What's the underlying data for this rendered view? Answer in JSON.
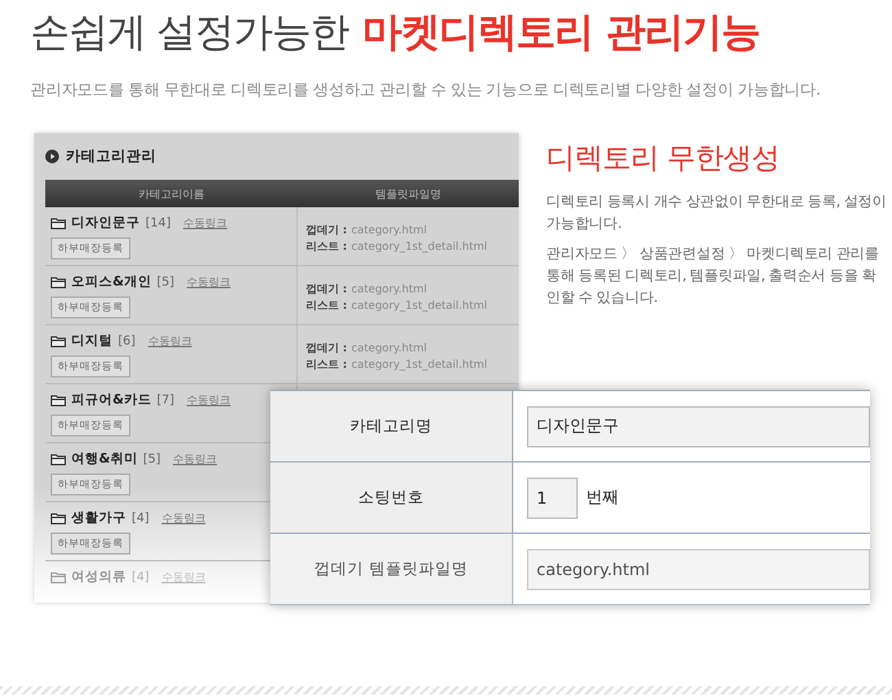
{
  "header": {
    "title": "손쉽게 설정가능한",
    "title_highlight": "마켓디렉토리 관리기능",
    "subtitle": "관리자모드를 통해 무한대로 디렉토리를 생성하고 관리할 수 있는 기능으로 디렉토리별 다양한 설정이 가능합니다."
  },
  "panel": {
    "title": "카테고리관리",
    "columns": [
      "카테고리이름",
      "템플릿파일명"
    ],
    "rows": [
      {
        "name": "디자인문구",
        "count": "[14]",
        "link": "수동링크",
        "button": "하부매장등록",
        "templates": [
          {
            "label": "껍데기 :",
            "value": "category.html"
          },
          {
            "label": "리스트 :",
            "value": "category_1st_detail.html"
          }
        ]
      },
      {
        "name": "오피스&개인",
        "count": "[5]",
        "link": "수동링크",
        "button": "하부매장등록",
        "templates": [
          {
            "label": "껍데기 :",
            "value": "category.html"
          },
          {
            "label": "리스트 :",
            "value": "category_1st_detail.html"
          }
        ]
      },
      {
        "name": "디지털",
        "count": "[6]",
        "link": "수동링크",
        "button": "하부매장등록",
        "templates": [
          {
            "label": "껍데기 :",
            "value": "category.html"
          },
          {
            "label": "리스트 :",
            "value": "category_1st_detail.html"
          }
        ]
      },
      {
        "name": "피규어&카드",
        "count": "[7]",
        "link": "수동링크",
        "button": "하부매장등록"
      },
      {
        "name": "여행&취미",
        "count": "[5]",
        "link": "수동링크",
        "button": "하부매장등록"
      },
      {
        "name": "생활가구",
        "count": "[4]",
        "link": "수동링크",
        "button": "하부매장등록"
      },
      {
        "name": "여성의류",
        "count": "[4]",
        "link": "수동링크"
      }
    ]
  },
  "feature": {
    "heading": "디렉토리 무한생성",
    "paragraphs": [
      "디렉토리 등록시 개수 상관없이 무한대로 등록, 설정이 가능합니다.",
      "관리자모드 〉 상품관련설정 〉 마켓디렉토리 관리를 통해 등록된 디렉토리, 템플릿파일, 출력순서 등을 확인할 수 있습니다."
    ]
  },
  "form": {
    "rows": [
      {
        "label": "카테고리명",
        "kind": "text",
        "value": "디자인문구"
      },
      {
        "label": "소팅번호",
        "kind": "number",
        "value": "1",
        "suffix": "번째"
      },
      {
        "label": "껍데기 템플릿파일명",
        "kind": "text",
        "value": "category.html"
      }
    ]
  }
}
